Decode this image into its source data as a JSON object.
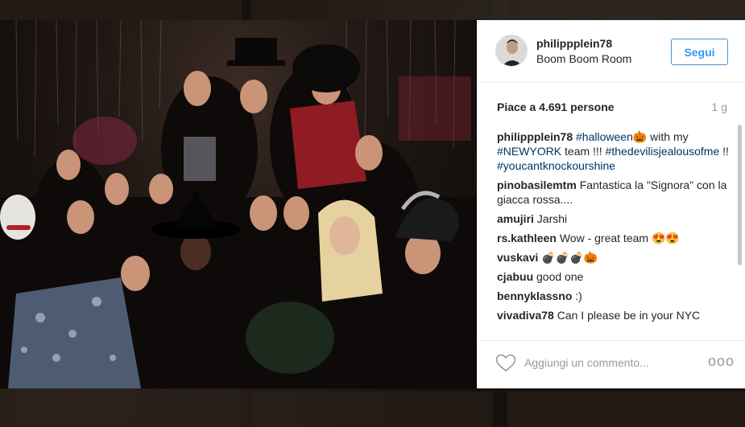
{
  "post": {
    "user": {
      "username": "philippplein78",
      "location": "Boom Boom Room",
      "avatar_icon": "profile-avatar-icon"
    },
    "follow_label": "Segui",
    "likes_text": "Piace a 4.691 persone",
    "timestamp": "1 g",
    "caption": {
      "author": "philippplein78",
      "parts": [
        {
          "t": "tag",
          "v": "#halloween"
        },
        {
          "t": "emoji",
          "v": "🎃"
        },
        {
          "t": "text",
          "v": " with my "
        },
        {
          "t": "tag",
          "v": "#NEWYORK"
        },
        {
          "t": "text",
          "v": " team !!! "
        },
        {
          "t": "tag",
          "v": "#thedevilisjealousofme"
        },
        {
          "t": "text",
          "v": " !! "
        },
        {
          "t": "tag",
          "v": "#youcantknockourshine"
        }
      ]
    },
    "comments": [
      {
        "author": "pinobasilemtm",
        "text": "Fantastica la \"Signora\" con la giacca rossa...."
      },
      {
        "author": "amujiri",
        "text": "Jarshi"
      },
      {
        "author": "rs.kathleen",
        "text": "Wow - great team 😍😍"
      },
      {
        "author": "vuskavi",
        "text": "💣💣💣🎃"
      },
      {
        "author": "cjabuu",
        "text": "good one"
      },
      {
        "author": "bennyklassno",
        "text": ":)"
      },
      {
        "author": "vivadiva78",
        "text": "Can I please be in your NYC"
      }
    ],
    "comment_placeholder": "Aggiungi un commento...",
    "more_label": "ooo"
  },
  "colors": {
    "link": "#003569",
    "follow": "#3897f0",
    "muted": "#999999",
    "text": "#262626"
  },
  "icons": {
    "like": "heart-icon",
    "options": "more-options-icon"
  }
}
